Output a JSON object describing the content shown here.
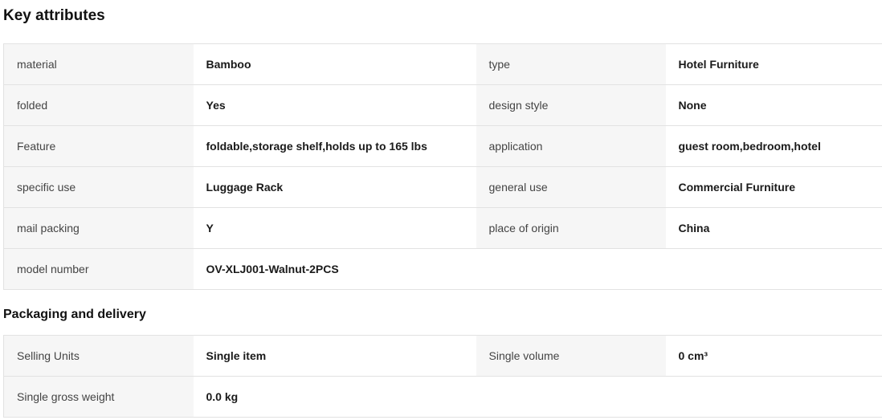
{
  "key_attributes": {
    "title": "Key attributes",
    "rows": [
      [
        {
          "label": "material",
          "value": "Bamboo"
        },
        {
          "label": "type",
          "value": "Hotel Furniture"
        }
      ],
      [
        {
          "label": "folded",
          "value": "Yes"
        },
        {
          "label": "design style",
          "value": "None"
        }
      ],
      [
        {
          "label": "Feature",
          "value": "foldable,storage shelf,holds up to 165 lbs"
        },
        {
          "label": "application",
          "value": "guest room,bedroom,hotel"
        }
      ],
      [
        {
          "label": "specific use",
          "value": "Luggage Rack"
        },
        {
          "label": "general use",
          "value": "Commercial Furniture"
        }
      ],
      [
        {
          "label": "mail packing",
          "value": "Y"
        },
        {
          "label": "place of origin",
          "value": "China"
        }
      ],
      [
        {
          "label": "model number",
          "value": "OV-XLJ001-Walnut-2PCS"
        },
        {
          "label": "",
          "value": ""
        }
      ]
    ]
  },
  "packaging": {
    "title": "Packaging and delivery",
    "rows": [
      [
        {
          "label": "Selling Units",
          "value": "Single item"
        },
        {
          "label": "Single volume",
          "value": "0 cm³"
        }
      ],
      [
        {
          "label": "Single gross weight",
          "value": "0.0 kg"
        },
        {
          "label": "",
          "value": ""
        }
      ]
    ]
  }
}
